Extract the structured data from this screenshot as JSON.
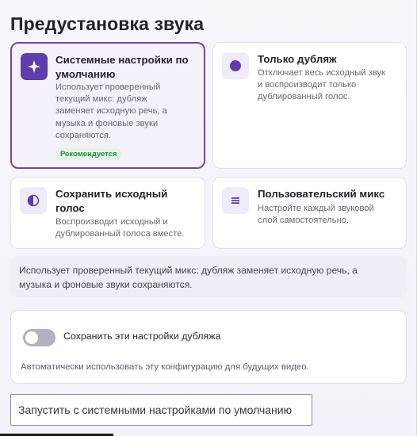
{
  "page": {
    "title": "Предустановка звука"
  },
  "presets": [
    {
      "title_line1": "Системные настройки по",
      "title_line2": "умолчанию",
      "desc_lines": [
        "Использует проверенный",
        "текущий микс: дубляж",
        "заменяет исходную речь, а",
        "музыка и фоновые звуки",
        "сохраняются."
      ],
      "badge": "Рекомендуется",
      "icon": "sparkle-icon"
    },
    {
      "title_line1": "Только дубляж",
      "desc_lines": [
        "Отключает весь исходный звук",
        "и воспроизводит только",
        "дублированный голос."
      ],
      "icon": "dot-icon"
    },
    {
      "title_line1": "Сохранить исходный",
      "title_line2": "голос",
      "desc_lines": [
        "Воспроизводит исходный и",
        "дублированный голоса вместе."
      ],
      "icon": "half-circle-icon"
    },
    {
      "title_line1": "Пользовательский микс",
      "desc_lines": [
        "Настройте каждый звуковой",
        "слой самостоятельно."
      ],
      "icon": "list-icon"
    }
  ],
  "info": {
    "line1": "Использует проверенный текущий микс: дубляж заменяет исходную речь, а",
    "line2": "музыка и фоновые звуки сохраняются."
  },
  "save": {
    "toggle_label": "Сохранить эти настройки дубляжа",
    "toggle_on": false,
    "hint": "Автоматически использовать эту конфигурацию для будущих видео."
  },
  "actions": {
    "launch_label": "Запустить с системными настройками по умолчанию"
  },
  "colors": {
    "accent": "#5e3dad",
    "badge_bg": "#e3f5e7",
    "badge_text": "#2a8a43"
  }
}
